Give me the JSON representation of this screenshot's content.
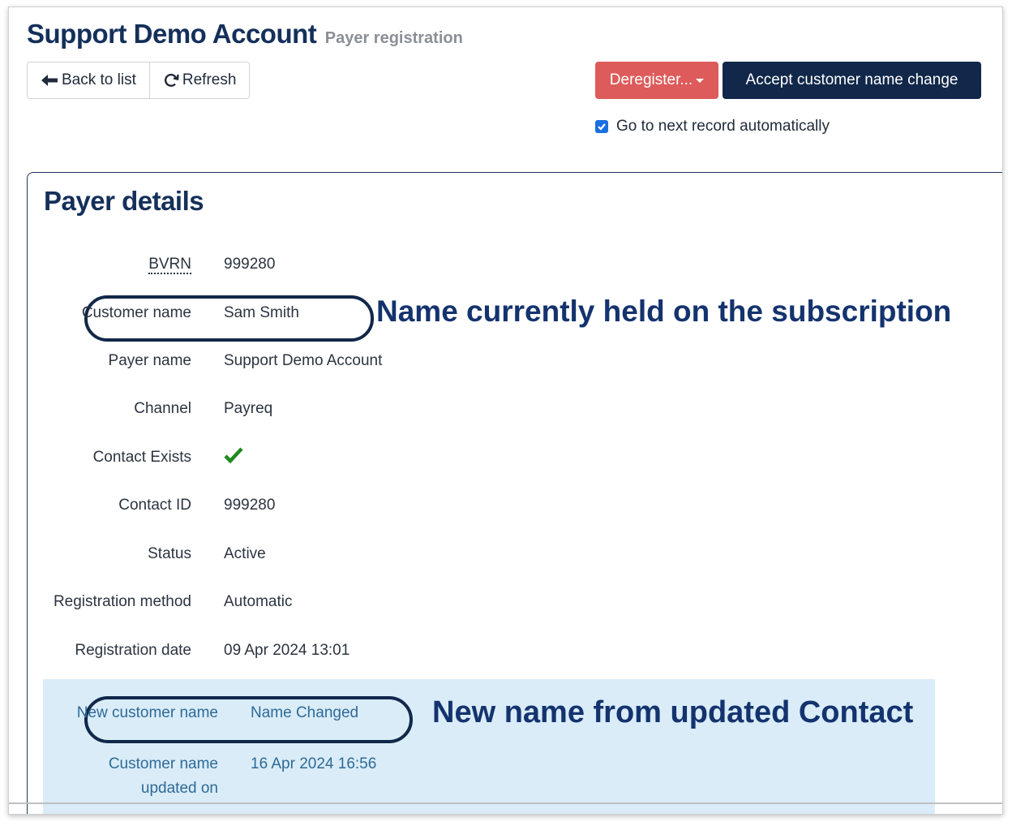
{
  "header": {
    "title": "Support Demo Account",
    "subtitle": "Payer registration"
  },
  "toolbar": {
    "back_label": "Back to list",
    "refresh_label": "Refresh",
    "deregister_label": "Deregister...",
    "accept_label": "Accept customer name change",
    "auto_next_label": "Go to next record automatically",
    "auto_next_checked": true
  },
  "panel": {
    "title": "Payer details",
    "fields": [
      {
        "label": "BVRN",
        "value": "999280"
      },
      {
        "label": "Customer name",
        "value": "Sam Smith"
      },
      {
        "label": "Payer name",
        "value": "Support Demo Account"
      },
      {
        "label": "Channel",
        "value": "Payreq"
      },
      {
        "label": "Contact Exists",
        "value": "check"
      },
      {
        "label": "Contact ID",
        "value": "999280"
      },
      {
        "label": "Status",
        "value": "Active"
      },
      {
        "label": "Registration method",
        "value": "Automatic"
      },
      {
        "label": "Registration date",
        "value": "09 Apr 2024 13:01"
      }
    ],
    "info_fields": [
      {
        "label": "New customer name",
        "value": "Name Changed"
      },
      {
        "label_line1": "Customer name",
        "label_line2": "updated on",
        "value": "16 Apr 2024 16:56"
      }
    ]
  },
  "annotations": {
    "current_name": "Name currently held on the subscription",
    "new_name": "New name from updated Contact"
  },
  "colors": {
    "navy": "#12284a",
    "danger": "#dd5b5b",
    "info_bg": "#d9ecf8",
    "info_text": "#2f6a96",
    "annotation": "#14336e",
    "check": "#1f8a1f"
  },
  "icons": [
    "arrow-left-icon",
    "refresh-icon",
    "checkmark-icon",
    "caret-down-icon"
  ]
}
